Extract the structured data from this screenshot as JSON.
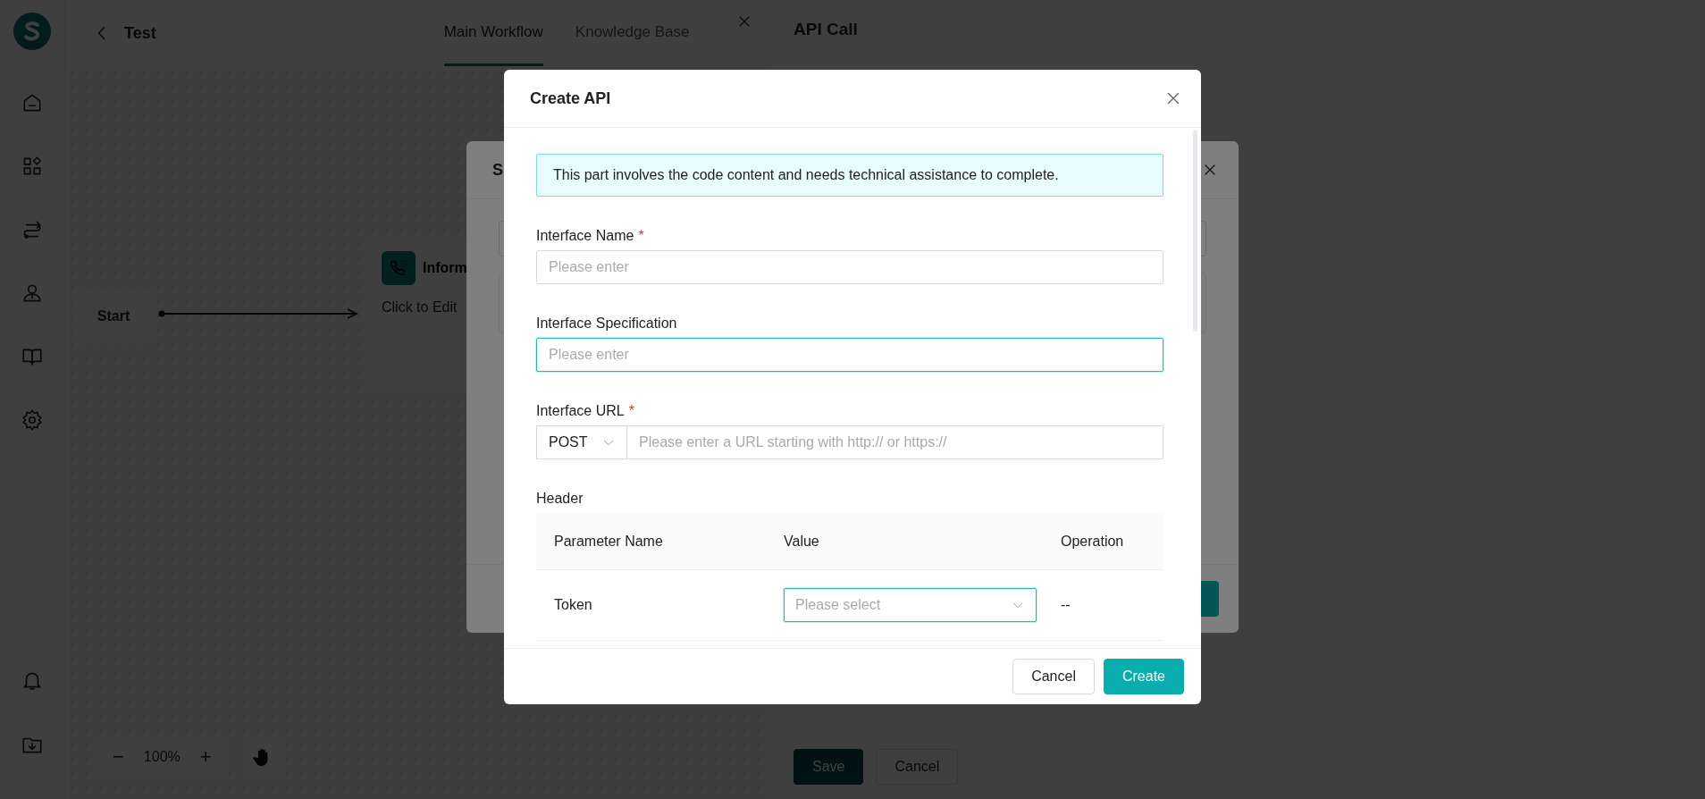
{
  "header": {
    "back_title": "Test",
    "tabs": [
      {
        "label": "Main Workflow",
        "selected": true
      },
      {
        "label": "Knowledge Base",
        "selected": false
      }
    ]
  },
  "canvas": {
    "nodes": [
      {
        "kind": "start",
        "title": "Start"
      },
      {
        "kind": "action",
        "title": "Inform",
        "subtitle": "Click to Edit"
      }
    ],
    "zoom_out": "−",
    "zoom": "100%",
    "zoom_in": "+"
  },
  "drawer": {
    "title": "API Call",
    "buttons": [
      {
        "label": "Save",
        "kind": "primary"
      },
      {
        "label": "Cancel",
        "kind": "default"
      }
    ]
  },
  "background_modal": {
    "title": "S"
  },
  "modal": {
    "title": "Create API",
    "required_mark": "*",
    "notice": "This part involves the code content and needs technical assistance to complete.",
    "fields": [
      {
        "kind": "text",
        "label": "Interface Name",
        "required": true,
        "placeholder": "Please enter",
        "focused": false
      },
      {
        "kind": "text",
        "label": "Interface Specification",
        "required": false,
        "placeholder": "Please enter",
        "focused": true
      },
      {
        "kind": "url",
        "label": "Interface URL",
        "required": true,
        "method": "POST",
        "placeholder": "Please enter a URL starting with http:// or https://",
        "focused": false
      }
    ],
    "header_label": "Header",
    "table": {
      "columns": [
        "Parameter Name",
        "Value",
        "Operation"
      ],
      "rows": [
        {
          "name": "Token",
          "value_placeholder": "Please select",
          "focused": true,
          "operation": "--"
        }
      ]
    },
    "buttons": [
      {
        "label": "Cancel",
        "kind": "default"
      },
      {
        "label": "Create",
        "kind": "primary"
      }
    ]
  }
}
